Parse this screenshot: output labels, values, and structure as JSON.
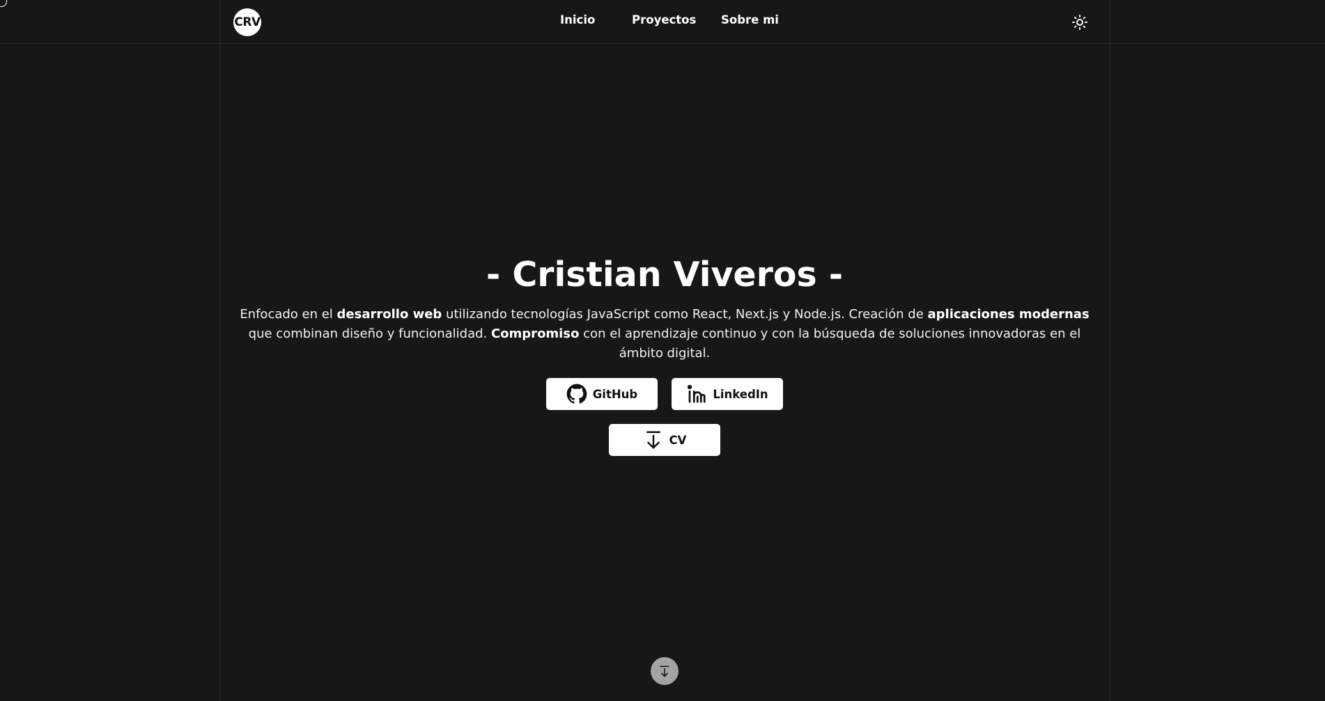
{
  "header": {
    "logo_text": "CRV",
    "nav": [
      {
        "label": "Inicio"
      },
      {
        "label": "Proyectos"
      },
      {
        "label": "Sobre mi"
      }
    ],
    "theme_toggle_icon": "sun-icon"
  },
  "hero": {
    "title": "- Cristian Viveros -",
    "description": {
      "p1": "Enfocado en el ",
      "b1": "desarrollo web",
      "p2": " utilizando tecnologías JavaScript como React, Next.js y Node.js. Creación de ",
      "b2": "aplicaciones modernas",
      "p3": " que combinan diseño y funcionalidad. ",
      "b3": "Compromiso",
      "p4": " con el aprendizaje continuo y con la búsqueda de soluciones innovadoras en el ámbito digital."
    },
    "buttons": {
      "github": {
        "label": "GitHub",
        "icon": "github-icon"
      },
      "linkedin": {
        "label": "LinkedIn",
        "icon": "linkedin-icon"
      },
      "cv": {
        "label": "CV",
        "icon": "download-icon"
      }
    }
  },
  "scroll_button": {
    "icon": "arrow-down-to-line-icon"
  },
  "colors": {
    "background": "#171717",
    "text": "#ffffff",
    "button_bg": "#ffffff",
    "button_text": "#111111",
    "scroll_button_bg": "#a3a3a3",
    "divider": "#2b2b2b"
  }
}
